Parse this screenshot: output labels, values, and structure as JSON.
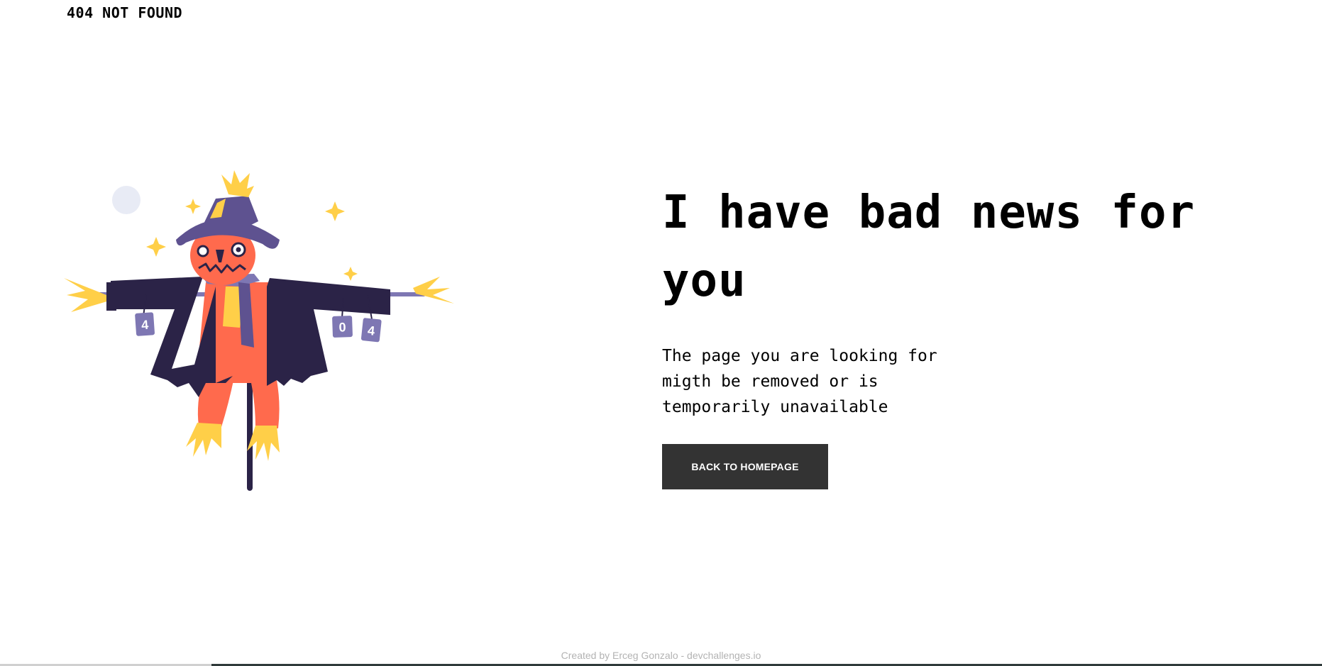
{
  "header": {
    "title": "404 NOT FOUND"
  },
  "main": {
    "headline": "I have bad news for you",
    "message": "The page you are looking for migth be removed or is temporarily unavailable",
    "button_label": "BACK TO HOMEPAGE"
  },
  "illustration": {
    "tag_1": "4",
    "tag_2": "0",
    "tag_3": "4"
  },
  "footer": {
    "credit": "Created by Erceg Gonzalo - devchallenges.io"
  },
  "colors": {
    "button_bg": "#333333",
    "button_text": "#ffffff",
    "coat": "#2b2347",
    "hat": "#5e5290",
    "skin": "#ff6a4d",
    "straw": "#ffcf48",
    "tag": "#7e77b3",
    "moon": "#e8ebf5",
    "footer_text": "#b3b3b3"
  },
  "icons": [
    "scarecrow-illustration",
    "sparkle-icon",
    "moon-icon"
  ]
}
